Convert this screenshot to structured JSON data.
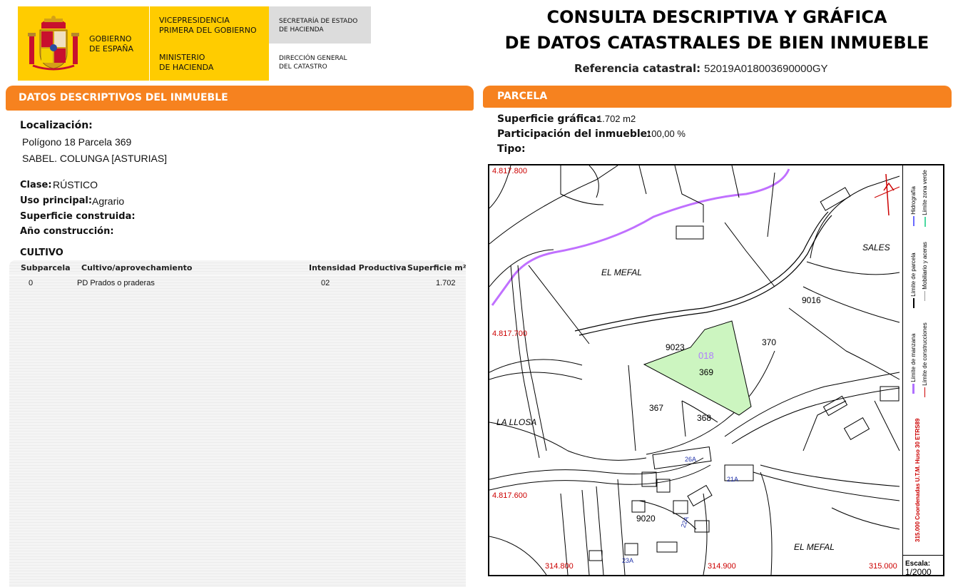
{
  "header": {
    "gov_line1": "GOBIERNO",
    "gov_line2": "DE ESPAÑA",
    "vice_line1": "VICEPRESIDENCIA",
    "vice_line2": "PRIMERA DEL GOBIERNO",
    "min_line1": "MINISTERIO",
    "min_line2": "DE HACIENDA",
    "sec_line1": "SECRETARÍA DE ESTADO",
    "sec_line2": "DE HACIENDA",
    "dir_line1": "DIRECCIÓN GENERAL",
    "dir_line2": "DEL CATASTRO",
    "title_line1": "CONSULTA DESCRIPTIVA Y GRÁFICA",
    "title_line2": "DE DATOS CATASTRALES DE BIEN INMUEBLE",
    "ref_label": "Referencia catastral:",
    "ref_value": "52019A018003690000GY"
  },
  "left": {
    "section_title": "DATOS DESCRIPTIVOS DEL INMUEBLE",
    "loc_label": "Localización:",
    "loc_line1": "Polígono 18 Parcela 369",
    "loc_line2": "SABEL. COLUNGA [ASTURIAS]",
    "clase_label": "Clase:",
    "clase_value": "RÚSTICO",
    "uso_label": "Uso principal:",
    "uso_value": "Agrario",
    "sup_label": "Superficie construida:",
    "anio_label": "Año construcción:",
    "cultivo_title": "CULTIVO",
    "table_headers": [
      "Subparcela",
      "Cultivo/aprovechamiento",
      "Intensidad Productiva",
      "Superficie m²"
    ],
    "rows": [
      {
        "subparcela": "0",
        "cultivo": "PD Prados o praderas",
        "intensidad": "02",
        "superficie": "1.702"
      }
    ]
  },
  "right": {
    "section_title": "PARCELA",
    "supg_label": "Superficie gráfica:",
    "supg_value": "1.702 m2",
    "part_label": "Participación del inmueble:",
    "part_value": "100,00 %",
    "tipo_label": "Tipo:"
  },
  "map": {
    "coords": {
      "y800": "4.817.800",
      "y700": "4.817.700",
      "y600": "4.817.600",
      "x800": "314.800",
      "x900": "314.900",
      "x000": "315.000"
    },
    "places": {
      "el_mefal_top": "EL MEFAL",
      "sales": "SALES",
      "la_llosa": "LA LLOSA",
      "el_mefal_bottom": "EL MEFAL"
    },
    "parcels": {
      "p9016": "9016",
      "p9023": "9023",
      "p018": "018",
      "p369": "369",
      "p370": "370",
      "p367": "367",
      "p368": "368",
      "p9020": "9020",
      "b26a": "26A",
      "b21a": "21A",
      "b22a": "22A",
      "b23a": "23A"
    },
    "legend": {
      "hidrografia": "Hidrografía",
      "limite_zona_verde": "Límite zona verde",
      "limite_parcela": "Límite de parcela",
      "mobiliario": "Mobiliario y aceras",
      "limite_manzana": "Límite de manzana",
      "limite_construcciones": "Límite de construcciones",
      "coordenadas": "Coordenadas U.T.M. Huso 30 ETRS89",
      "coord_value": "315.000",
      "escala_label": "Escala:",
      "escala_value": "1/2000"
    },
    "colors": {
      "parcel_fill": "#ccf5c0",
      "hydro": "#c070ff",
      "coords_red": "#cc0000",
      "orange": "#f6821f"
    }
  }
}
